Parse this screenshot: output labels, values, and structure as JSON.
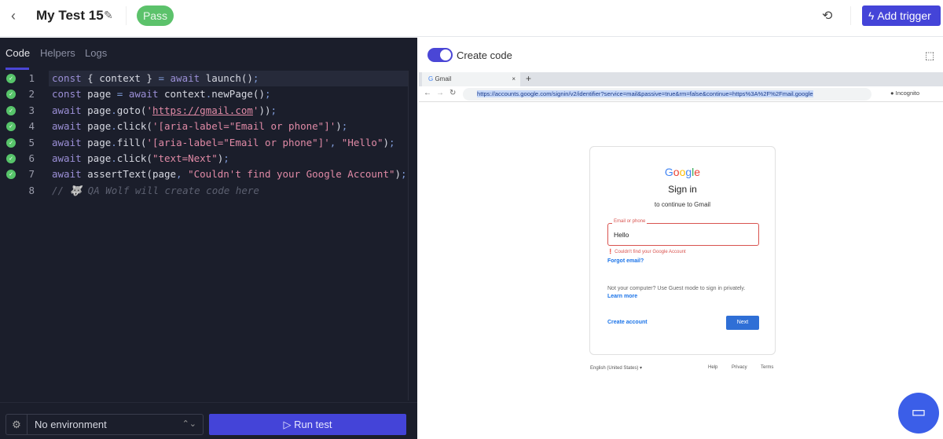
{
  "header": {
    "title": "My Test 15",
    "status": "Pass",
    "add_trigger": "Add trigger"
  },
  "tabs": [
    "Code",
    "Helpers",
    "Logs"
  ],
  "code": [
    [
      [
        "kw",
        "const "
      ],
      [
        "",
        "{ context } "
      ],
      [
        "pun",
        "= "
      ],
      [
        "kw",
        "await "
      ],
      [
        "",
        "launch()"
      ],
      [
        "pun",
        ";"
      ]
    ],
    [
      [
        "kw",
        "const "
      ],
      [
        "",
        "page "
      ],
      [
        "pun",
        "= "
      ],
      [
        "kw",
        "await "
      ],
      [
        "",
        "context"
      ],
      [
        "pun",
        "."
      ],
      [
        "",
        "newPage()"
      ],
      [
        "pun",
        ";"
      ]
    ],
    [
      [
        "kw",
        "await "
      ],
      [
        "",
        "page"
      ],
      [
        "pun",
        "."
      ],
      [
        "",
        "goto("
      ],
      [
        "str",
        "'"
      ],
      [
        "url",
        "https://gmail.com"
      ],
      [
        "str",
        "'"
      ],
      [
        "",
        "))"
      ],
      [
        "pun",
        ";"
      ]
    ],
    [
      [
        "kw",
        "await "
      ],
      [
        "",
        "page"
      ],
      [
        "pun",
        "."
      ],
      [
        "",
        "click("
      ],
      [
        "str",
        "'[aria-label=\"Email or phone\"]'"
      ],
      [
        "",
        ")"
      ],
      [
        "pun",
        ";"
      ]
    ],
    [
      [
        "kw",
        "await "
      ],
      [
        "",
        "page"
      ],
      [
        "pun",
        "."
      ],
      [
        "",
        "fill("
      ],
      [
        "str",
        "'[aria-label=\"Email or phone\"]'"
      ],
      [
        "pun",
        ", "
      ],
      [
        "str",
        "\"Hello\""
      ],
      [
        "",
        ")"
      ],
      [
        "pun",
        ";"
      ]
    ],
    [
      [
        "kw",
        "await "
      ],
      [
        "",
        "page"
      ],
      [
        "pun",
        "."
      ],
      [
        "",
        "click("
      ],
      [
        "str",
        "\"text=Next\""
      ],
      [
        "",
        ")"
      ],
      [
        "pun",
        ";"
      ]
    ],
    [
      [
        "kw",
        "await "
      ],
      [
        "",
        "assertText(page"
      ],
      [
        "pun",
        ", "
      ],
      [
        "str",
        "\"Couldn't find your Google Account\""
      ],
      [
        "",
        ")"
      ],
      [
        "pun",
        ";"
      ]
    ],
    [
      [
        "cmt",
        "// 🐺 QA Wolf will create code here"
      ]
    ]
  ],
  "bottom": {
    "environment": "No environment",
    "run": "Run test"
  },
  "right": {
    "toggle_label": "Create code",
    "toggle_on": true
  },
  "browser": {
    "tab": "Gmail",
    "url": "https://accounts.google.com/signin/v2/identifier?service=mail&passive=true&rm=false&continue=https%3A%2F%2Fmail.google",
    "profile": "Incognito"
  },
  "google": {
    "logo": "Google",
    "title": "Sign in",
    "subtitle": "to continue to Gmail",
    "field_label": "Email or phone",
    "field_value": "Hello",
    "error": "Couldn't find your Google Account",
    "forgot": "Forgot email?",
    "note": "Not your computer? Use Guest mode to sign in privately.",
    "learn": "Learn more",
    "create": "Create account",
    "next": "Next",
    "language": "English (United States)",
    "help": "Help",
    "privacy": "Privacy",
    "terms": "Terms"
  },
  "colors": {
    "accent": "#4444d8",
    "pass": "#5cc26b",
    "editor_bg": "#1b1e2b",
    "error": "#d9534f"
  }
}
